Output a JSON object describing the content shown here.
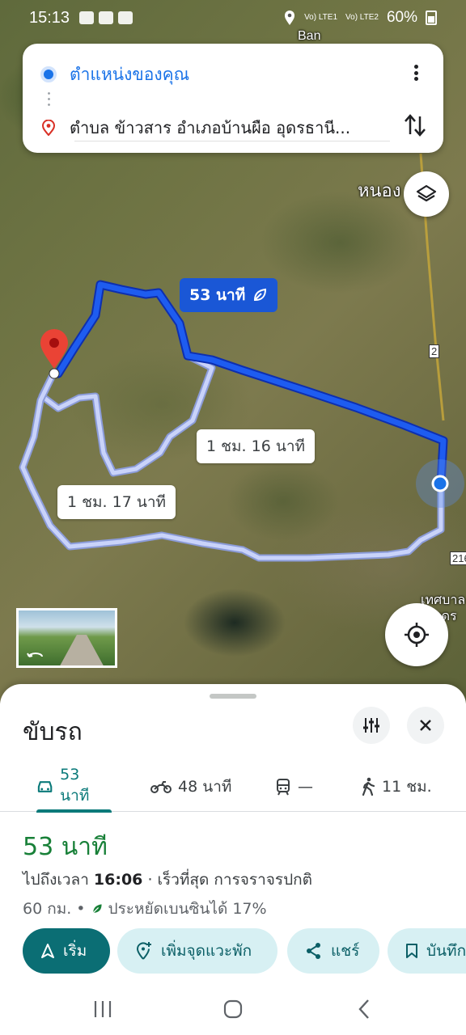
{
  "status_bar": {
    "time": "15:13",
    "battery": "60%",
    "network1": "Vo) LTE1",
    "network2": "Vo) LTE2"
  },
  "map": {
    "labels": [
      "Ban",
      "หนอง",
      "2",
      "216",
      "เทศบาล",
      "อุดร"
    ],
    "route_primary_label": "53 นาที",
    "route_alt1_label": "1 ชม. 16 นาที",
    "route_alt2_label": "1 ชม. 17 นาที",
    "icons": {
      "layers": "layers-icon",
      "my_location": "my-location-icon",
      "destination": "red-pin-icon",
      "eco": "leaf-icon"
    },
    "colors": {
      "primary_route": "#1a57d6",
      "alt_route": "#b9c6f5",
      "pin": "#ea4335"
    }
  },
  "search": {
    "origin": "ตำแหน่งของคุณ",
    "destination": "ตำบล ข้าวสาร อำเภอบ้านผือ อุดรธานี..."
  },
  "sheet": {
    "title": "ขับรถ",
    "tabs": [
      {
        "label": "53 นาที",
        "icon": "car-icon"
      },
      {
        "label": "48 นาที",
        "icon": "motorcycle-icon"
      },
      {
        "label": "—",
        "icon": "train-icon"
      },
      {
        "label": "11 ชม.",
        "icon": "walk-icon"
      }
    ],
    "duration": "53 นาที",
    "arrival_prefix": "ไปถึงเวลา ",
    "arrival_time": "16:06",
    "arrival_suffix": " · เร็วที่สุด การจราจรปกติ",
    "distance": "60 กม.",
    "bullet": "•",
    "fuel_saving": "ประหยัดเบนซินได้ 17%",
    "actions": [
      {
        "label": "เริ่ม",
        "icon": "navigation-arrow-icon"
      },
      {
        "label": "เพิ่มจุดแวะพัก",
        "icon": "add-stop-icon"
      },
      {
        "label": "แชร์",
        "icon": "share-icon"
      },
      {
        "label": "บันทึก",
        "icon": "bookmark-icon"
      }
    ],
    "colors": {
      "accent": "#0b6e74",
      "duration": "#188038",
      "chip_bg": "#d7f0f3"
    }
  }
}
